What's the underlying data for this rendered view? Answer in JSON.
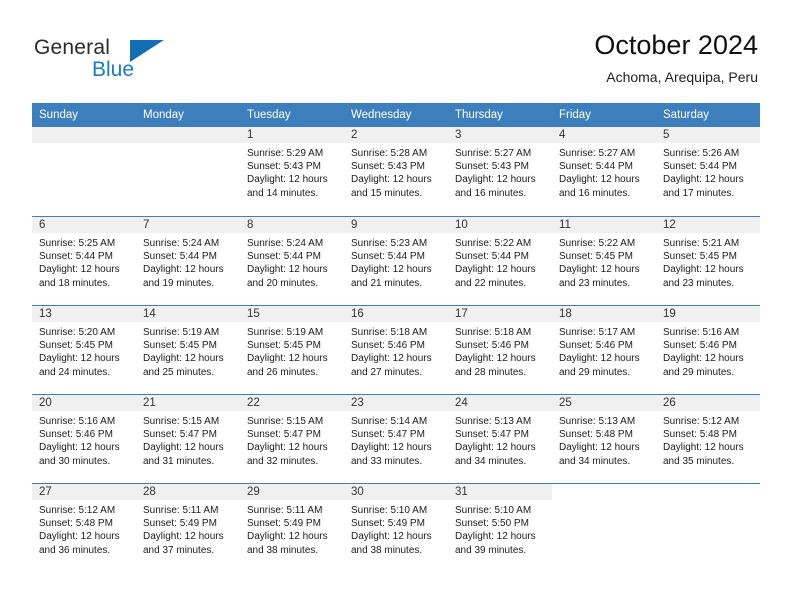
{
  "brand": {
    "word1": "General",
    "word2": "Blue",
    "triangle_color": "#146eb4",
    "blue_color": "#1a7cc4"
  },
  "header": {
    "month_title": "October 2024",
    "location": "Achoma, Arequipa, Peru"
  },
  "theme": {
    "header_bg": "#3d7ebd",
    "daynum_bg": "#f0f0f0",
    "grid_line": "#3d7ebd",
    "text": "#1c1c1c"
  },
  "weekday_headers": [
    "Sunday",
    "Monday",
    "Tuesday",
    "Wednesday",
    "Thursday",
    "Friday",
    "Saturday"
  ],
  "labels": {
    "sunrise_prefix": "Sunrise:",
    "sunset_prefix": "Sunset:",
    "daylight_prefix": "Daylight:"
  },
  "weeks": [
    [
      {
        "day": "",
        "empty": true
      },
      {
        "day": "",
        "empty": true
      },
      {
        "day": "1",
        "sunrise": "Sunrise: 5:29 AM",
        "sunset": "Sunset: 5:43 PM",
        "daylight_line1": "Daylight: 12 hours",
        "daylight_line2": "and 14 minutes."
      },
      {
        "day": "2",
        "sunrise": "Sunrise: 5:28 AM",
        "sunset": "Sunset: 5:43 PM",
        "daylight_line1": "Daylight: 12 hours",
        "daylight_line2": "and 15 minutes."
      },
      {
        "day": "3",
        "sunrise": "Sunrise: 5:27 AM",
        "sunset": "Sunset: 5:43 PM",
        "daylight_line1": "Daylight: 12 hours",
        "daylight_line2": "and 16 minutes."
      },
      {
        "day": "4",
        "sunrise": "Sunrise: 5:27 AM",
        "sunset": "Sunset: 5:44 PM",
        "daylight_line1": "Daylight: 12 hours",
        "daylight_line2": "and 16 minutes."
      },
      {
        "day": "5",
        "sunrise": "Sunrise: 5:26 AM",
        "sunset": "Sunset: 5:44 PM",
        "daylight_line1": "Daylight: 12 hours",
        "daylight_line2": "and 17 minutes."
      }
    ],
    [
      {
        "day": "6",
        "sunrise": "Sunrise: 5:25 AM",
        "sunset": "Sunset: 5:44 PM",
        "daylight_line1": "Daylight: 12 hours",
        "daylight_line2": "and 18 minutes."
      },
      {
        "day": "7",
        "sunrise": "Sunrise: 5:24 AM",
        "sunset": "Sunset: 5:44 PM",
        "daylight_line1": "Daylight: 12 hours",
        "daylight_line2": "and 19 minutes."
      },
      {
        "day": "8",
        "sunrise": "Sunrise: 5:24 AM",
        "sunset": "Sunset: 5:44 PM",
        "daylight_line1": "Daylight: 12 hours",
        "daylight_line2": "and 20 minutes."
      },
      {
        "day": "9",
        "sunrise": "Sunrise: 5:23 AM",
        "sunset": "Sunset: 5:44 PM",
        "daylight_line1": "Daylight: 12 hours",
        "daylight_line2": "and 21 minutes."
      },
      {
        "day": "10",
        "sunrise": "Sunrise: 5:22 AM",
        "sunset": "Sunset: 5:44 PM",
        "daylight_line1": "Daylight: 12 hours",
        "daylight_line2": "and 22 minutes."
      },
      {
        "day": "11",
        "sunrise": "Sunrise: 5:22 AM",
        "sunset": "Sunset: 5:45 PM",
        "daylight_line1": "Daylight: 12 hours",
        "daylight_line2": "and 23 minutes."
      },
      {
        "day": "12",
        "sunrise": "Sunrise: 5:21 AM",
        "sunset": "Sunset: 5:45 PM",
        "daylight_line1": "Daylight: 12 hours",
        "daylight_line2": "and 23 minutes."
      }
    ],
    [
      {
        "day": "13",
        "sunrise": "Sunrise: 5:20 AM",
        "sunset": "Sunset: 5:45 PM",
        "daylight_line1": "Daylight: 12 hours",
        "daylight_line2": "and 24 minutes."
      },
      {
        "day": "14",
        "sunrise": "Sunrise: 5:19 AM",
        "sunset": "Sunset: 5:45 PM",
        "daylight_line1": "Daylight: 12 hours",
        "daylight_line2": "and 25 minutes."
      },
      {
        "day": "15",
        "sunrise": "Sunrise: 5:19 AM",
        "sunset": "Sunset: 5:45 PM",
        "daylight_line1": "Daylight: 12 hours",
        "daylight_line2": "and 26 minutes."
      },
      {
        "day": "16",
        "sunrise": "Sunrise: 5:18 AM",
        "sunset": "Sunset: 5:46 PM",
        "daylight_line1": "Daylight: 12 hours",
        "daylight_line2": "and 27 minutes."
      },
      {
        "day": "17",
        "sunrise": "Sunrise: 5:18 AM",
        "sunset": "Sunset: 5:46 PM",
        "daylight_line1": "Daylight: 12 hours",
        "daylight_line2": "and 28 minutes."
      },
      {
        "day": "18",
        "sunrise": "Sunrise: 5:17 AM",
        "sunset": "Sunset: 5:46 PM",
        "daylight_line1": "Daylight: 12 hours",
        "daylight_line2": "and 29 minutes."
      },
      {
        "day": "19",
        "sunrise": "Sunrise: 5:16 AM",
        "sunset": "Sunset: 5:46 PM",
        "daylight_line1": "Daylight: 12 hours",
        "daylight_line2": "and 29 minutes."
      }
    ],
    [
      {
        "day": "20",
        "sunrise": "Sunrise: 5:16 AM",
        "sunset": "Sunset: 5:46 PM",
        "daylight_line1": "Daylight: 12 hours",
        "daylight_line2": "and 30 minutes."
      },
      {
        "day": "21",
        "sunrise": "Sunrise: 5:15 AM",
        "sunset": "Sunset: 5:47 PM",
        "daylight_line1": "Daylight: 12 hours",
        "daylight_line2": "and 31 minutes."
      },
      {
        "day": "22",
        "sunrise": "Sunrise: 5:15 AM",
        "sunset": "Sunset: 5:47 PM",
        "daylight_line1": "Daylight: 12 hours",
        "daylight_line2": "and 32 minutes."
      },
      {
        "day": "23",
        "sunrise": "Sunrise: 5:14 AM",
        "sunset": "Sunset: 5:47 PM",
        "daylight_line1": "Daylight: 12 hours",
        "daylight_line2": "and 33 minutes."
      },
      {
        "day": "24",
        "sunrise": "Sunrise: 5:13 AM",
        "sunset": "Sunset: 5:47 PM",
        "daylight_line1": "Daylight: 12 hours",
        "daylight_line2": "and 34 minutes."
      },
      {
        "day": "25",
        "sunrise": "Sunrise: 5:13 AM",
        "sunset": "Sunset: 5:48 PM",
        "daylight_line1": "Daylight: 12 hours",
        "daylight_line2": "and 34 minutes."
      },
      {
        "day": "26",
        "sunrise": "Sunrise: 5:12 AM",
        "sunset": "Sunset: 5:48 PM",
        "daylight_line1": "Daylight: 12 hours",
        "daylight_line2": "and 35 minutes."
      }
    ],
    [
      {
        "day": "27",
        "sunrise": "Sunrise: 5:12 AM",
        "sunset": "Sunset: 5:48 PM",
        "daylight_line1": "Daylight: 12 hours",
        "daylight_line2": "and 36 minutes."
      },
      {
        "day": "28",
        "sunrise": "Sunrise: 5:11 AM",
        "sunset": "Sunset: 5:49 PM",
        "daylight_line1": "Daylight: 12 hours",
        "daylight_line2": "and 37 minutes."
      },
      {
        "day": "29",
        "sunrise": "Sunrise: 5:11 AM",
        "sunset": "Sunset: 5:49 PM",
        "daylight_line1": "Daylight: 12 hours",
        "daylight_line2": "and 38 minutes."
      },
      {
        "day": "30",
        "sunrise": "Sunrise: 5:10 AM",
        "sunset": "Sunset: 5:49 PM",
        "daylight_line1": "Daylight: 12 hours",
        "daylight_line2": "and 38 minutes."
      },
      {
        "day": "31",
        "sunrise": "Sunrise: 5:10 AM",
        "sunset": "Sunset: 5:50 PM",
        "daylight_line1": "Daylight: 12 hours",
        "daylight_line2": "and 39 minutes."
      },
      {
        "day": "",
        "blank": true
      },
      {
        "day": "",
        "blank": true
      }
    ]
  ]
}
